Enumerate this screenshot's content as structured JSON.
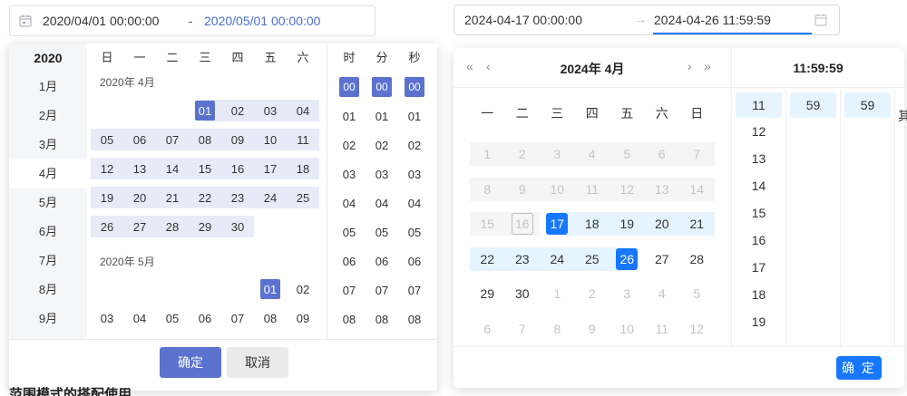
{
  "left_picker": {
    "input": {
      "start": "2020/04/01 00:00:00",
      "separator": "-",
      "end": "2020/05/01 00:00:00"
    },
    "year": "2020",
    "months": [
      "1月",
      "2月",
      "3月",
      "4月",
      "5月",
      "6月",
      "7月",
      "8月",
      "9月"
    ],
    "active_month": "4月",
    "weekdays": [
      "日",
      "一",
      "二",
      "三",
      "四",
      "五",
      "六"
    ],
    "april_title": "2020年 4月",
    "may_title": "2020年 5月",
    "april_days": [
      "",
      "",
      "",
      "01",
      "02",
      "03",
      "04",
      "05",
      "06",
      "07",
      "08",
      "09",
      "10",
      "11",
      "12",
      "13",
      "14",
      "15",
      "16",
      "17",
      "18",
      "19",
      "20",
      "21",
      "22",
      "23",
      "24",
      "25",
      "26",
      "27",
      "28",
      "29",
      "30"
    ],
    "may_days": [
      "",
      "",
      "",
      "",
      "",
      "01",
      "02",
      "03",
      "04",
      "05",
      "06",
      "07",
      "08",
      "09"
    ],
    "time_headers": [
      "时",
      "分",
      "秒"
    ],
    "time_values": [
      "00",
      "01",
      "02",
      "03",
      "04",
      "05",
      "06",
      "07",
      "08"
    ],
    "ok_label": "确定",
    "cancel_label": "取消",
    "accent_color": "#5b72cf"
  },
  "bottom_text": "范围模式的搭配使用",
  "right_picker": {
    "input": {
      "start": "2024-04-17 00:00:00",
      "arrow": "→",
      "end": "2024-04-26 11:59:59"
    },
    "nav": {
      "super_prev": "«",
      "prev": "‹",
      "next": "›",
      "super_next": "»"
    },
    "title": "2024年  4月",
    "weekdays": [
      "一",
      "二",
      "三",
      "四",
      "五",
      "六",
      "日"
    ],
    "days": [
      [
        "1",
        "2",
        "3",
        "4",
        "5",
        "6",
        "7"
      ],
      [
        "8",
        "9",
        "10",
        "11",
        "12",
        "13",
        "14"
      ],
      [
        "15",
        "16",
        "17",
        "18",
        "19",
        "20",
        "21"
      ],
      [
        "22",
        "23",
        "24",
        "25",
        "26",
        "27",
        "28"
      ],
      [
        "29",
        "30",
        "1",
        "2",
        "3",
        "4",
        "5"
      ],
      [
        "6",
        "7",
        "8",
        "9",
        "10",
        "11",
        "12"
      ]
    ],
    "time_title": "11:59:59",
    "hours": [
      "11",
      "12",
      "13",
      "14",
      "15",
      "16",
      "17",
      "18",
      "19"
    ],
    "minutes_selected": "59",
    "seconds_selected": "59",
    "ok_label": "确 定",
    "accent_color": "#1677ff"
  },
  "clipped_char": "其"
}
